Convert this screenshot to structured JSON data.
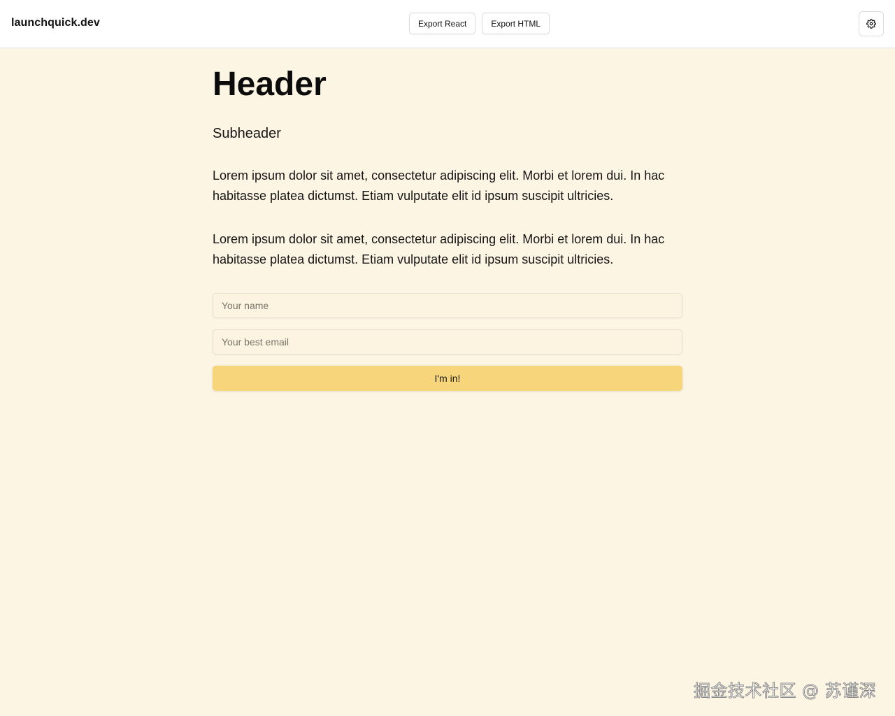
{
  "topbar": {
    "brand": "launchquick.dev",
    "export_react_label": "Export React",
    "export_html_label": "Export HTML",
    "settings_icon": "gear-icon"
  },
  "page": {
    "title": "Header",
    "subtitle": "Subheader",
    "paragraphs": [
      "Lorem ipsum dolor sit amet, consectetur adipiscing elit. Morbi et lorem dui. In hac habitasse platea dictumst. Etiam vulputate elit id ipsum suscipit ultricies.",
      "Lorem ipsum dolor sit amet, consectetur adipiscing elit. Morbi et lorem dui. In hac habitasse platea dictumst. Etiam vulputate elit id ipsum suscipit ultricies."
    ]
  },
  "form": {
    "name_value": "",
    "name_placeholder": "Your name",
    "email_value": "",
    "email_placeholder": "Your best email",
    "submit_label": "I'm in!"
  },
  "colors": {
    "page_bg": "#fdf5e4",
    "accent": "#f7d57a",
    "topbar_bg": "#ffffff"
  },
  "watermark": "掘金技术社区 @ 苏谨深"
}
